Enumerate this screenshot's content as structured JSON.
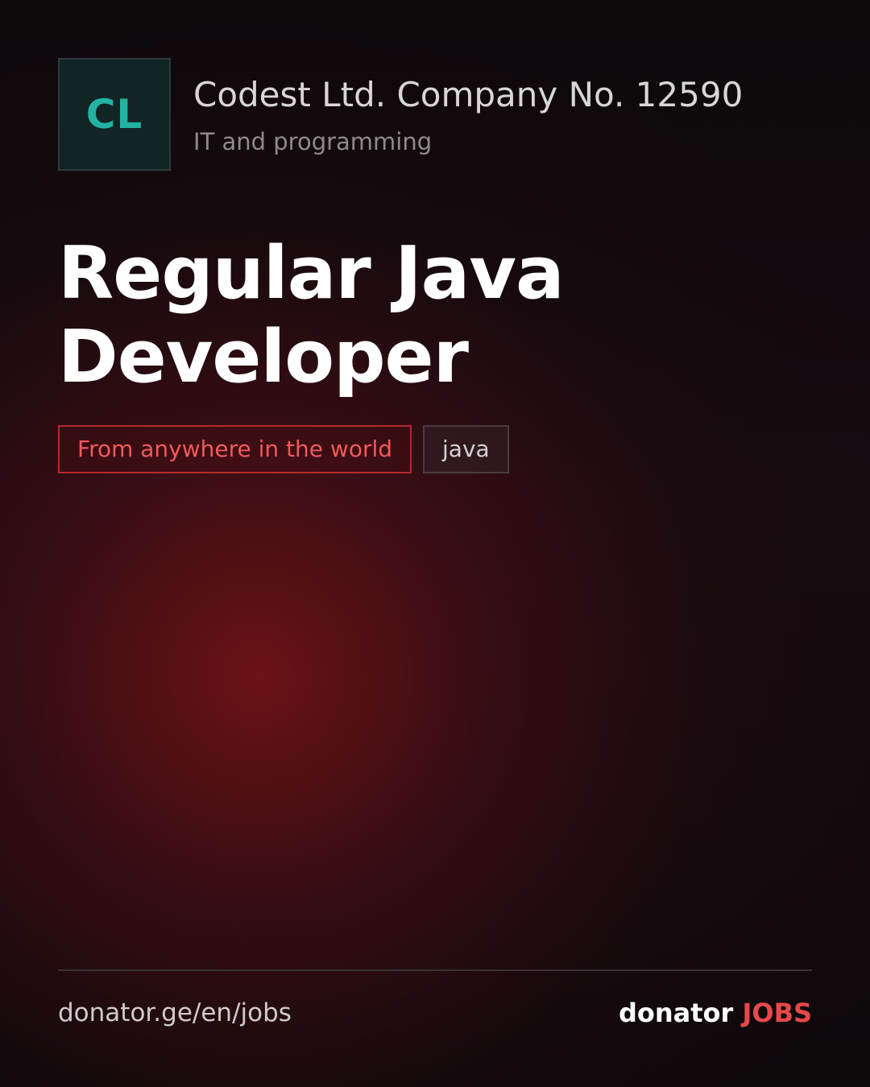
{
  "company": {
    "logo_initials": "CL",
    "name": "Codest Ltd. Company No. 12590...",
    "category": "IT and programming"
  },
  "job": {
    "title": "Regular Java Developer",
    "tags": {
      "location": "From anywhere in the world",
      "skill": "java"
    }
  },
  "footer": {
    "url": "donator.ge/en/jobs",
    "brand_word": "donator",
    "brand_jobs": "JOBS"
  },
  "colors": {
    "accent_red": "#e8484c",
    "logo_teal": "#22b3a3",
    "background": "#0c090b"
  }
}
